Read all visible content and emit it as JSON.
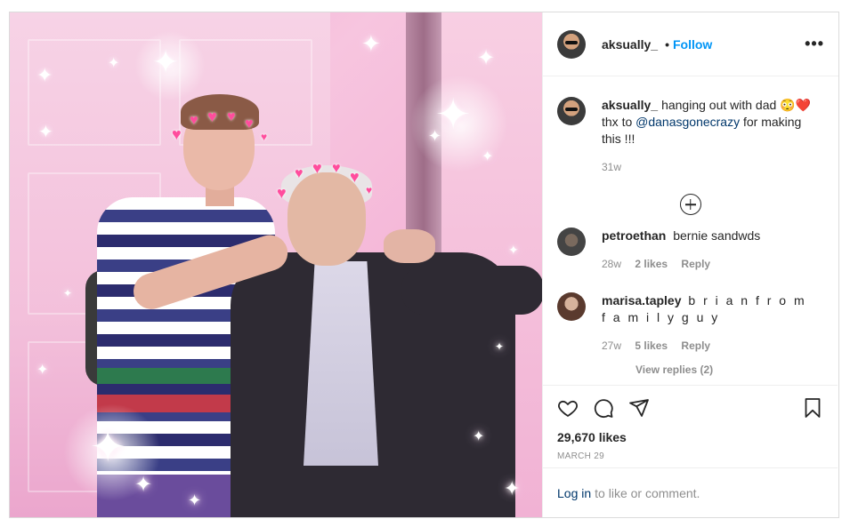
{
  "post": {
    "owner": "aksually_",
    "follow_label": "Follow",
    "separator": "•",
    "more_label": "•••"
  },
  "caption": {
    "username": "aksually_",
    "text_before": "hanging out with dad 😳❤️ thx to",
    "mention": "@danasgonecrazy",
    "text_after": "for making this !!!",
    "time": "31w"
  },
  "comments": [
    {
      "username": "petroethan",
      "text": "bernie sandwds",
      "time": "28w",
      "likes": "2 likes",
      "reply": "Reply"
    },
    {
      "username": "marisa.tapley",
      "text": "b r i a n f r o m f a m i l y g u y",
      "time": "27w",
      "likes": "5 likes",
      "reply": "Reply"
    }
  ],
  "view_replies_label": "View replies (2)",
  "likes_count": "29,670 likes",
  "date": "MARCH 29",
  "login": {
    "link": "Log in",
    "rest": "to like or comment."
  },
  "icons": [
    "heart-icon",
    "comment-icon",
    "share-icon",
    "bookmark-icon",
    "plus-circle-icon",
    "more-icon"
  ],
  "colors": {
    "accent": "#0095f6",
    "link": "#00376b",
    "muted": "#8e8e8e"
  }
}
